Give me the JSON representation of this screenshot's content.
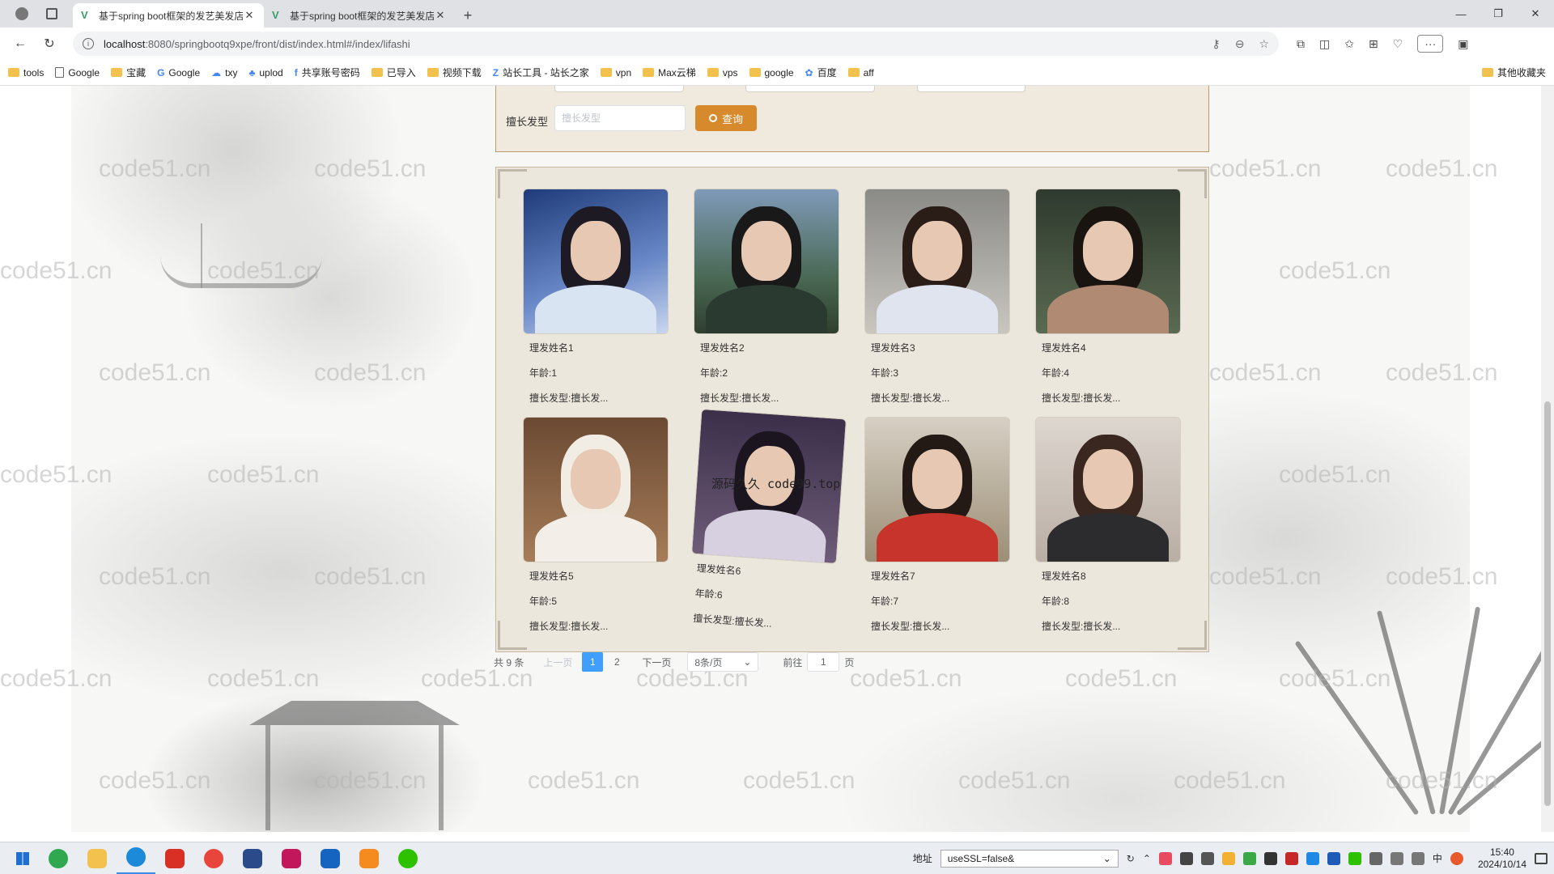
{
  "browser": {
    "tabs": [
      {
        "title": "基于spring boot框架的发艺美发店",
        "active": true
      },
      {
        "title": "基于spring boot框架的发艺美发店",
        "active": false
      }
    ],
    "url_host": "localhost",
    "url_path": ":8080/springbootq9xpe/front/dist/index.html#/index/lifashi",
    "bookmarks": [
      "tools",
      "Google",
      "宝藏",
      "Google",
      "txy",
      "uplod",
      "共享账号密码",
      "已导入",
      "视频下载",
      "站长工具 - 站长之家",
      "vpn",
      "Max云梯",
      "vps",
      "google",
      "百度",
      "aff"
    ],
    "bookmarks_other": "其他收藏夹"
  },
  "watermark": "code51.cn",
  "search": {
    "label": "擅长发型",
    "placeholder": "擅长发型",
    "button": "查询"
  },
  "overlay_note": "源码久久 code99.top",
  "cards": [
    {
      "name": "理发姓名1",
      "age": "年龄:1",
      "style": "擅长发型:擅长发..."
    },
    {
      "name": "理发姓名2",
      "age": "年龄:2",
      "style": "擅长发型:擅长发..."
    },
    {
      "name": "理发姓名3",
      "age": "年龄:3",
      "style": "擅长发型:擅长发..."
    },
    {
      "name": "理发姓名4",
      "age": "年龄:4",
      "style": "擅长发型:擅长发..."
    },
    {
      "name": "理发姓名5",
      "age": "年龄:5",
      "style": "擅长发型:擅长发..."
    },
    {
      "name": "理发姓名6",
      "age": "年龄:6",
      "style": "擅长发型:擅长发..."
    },
    {
      "name": "理发姓名7",
      "age": "年龄:7",
      "style": "擅长发型:擅长发..."
    },
    {
      "name": "理发姓名8",
      "age": "年龄:8",
      "style": "擅长发型:擅长发..."
    }
  ],
  "pager": {
    "total": "共 9 条",
    "prev": "上一页",
    "pages": [
      "1",
      "2"
    ],
    "current": "1",
    "next": "下一页",
    "page_size": "8条/页",
    "goto_label": "前往",
    "goto_value": "1",
    "goto_suffix": "页"
  },
  "taskbar": {
    "addr_label": "地址",
    "addr_value": "useSSL=false&",
    "ime": "中",
    "time": "15:40",
    "date": "2024/10/14"
  }
}
